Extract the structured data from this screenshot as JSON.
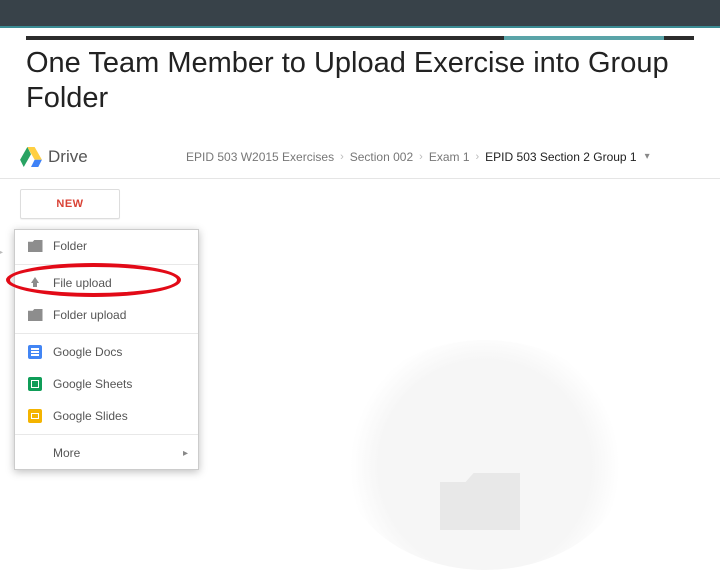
{
  "slide": {
    "title": "One Team Member to Upload Exercise into Group Folder"
  },
  "drive": {
    "brand": "Drive",
    "breadcrumb": {
      "root": "EPID 503 W2015 Exercises",
      "level1": "Section 002",
      "level2": "Exam 1",
      "current": "EPID 503 Section 2 Group 1"
    },
    "newButtonLabel": "NEW",
    "menu": {
      "folder": "Folder",
      "fileUpload": "File upload",
      "folderUpload": "Folder upload",
      "docs": "Google Docs",
      "sheets": "Google Sheets",
      "slides": "Google Slides",
      "more": "More"
    }
  }
}
